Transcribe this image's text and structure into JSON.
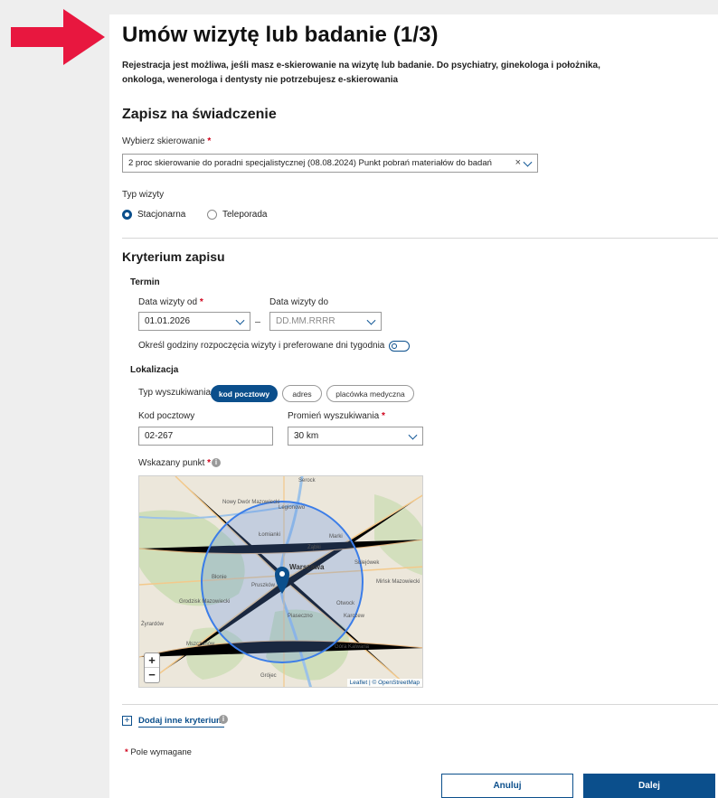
{
  "header": {
    "title": "Umów wizytę lub badanie (1/3)",
    "intro_line1": "Rejestracja jest możliwa, jeśli masz e-skierowanie na wizytę lub badanie. Do psychiatry, ginekologa i położnika,",
    "intro_line2": "onkologa, wenerologa i dentysty nie potrzebujesz e-skierowania"
  },
  "colors": {
    "accent": "#0b4f8c",
    "required": "#d0021b",
    "arrow": "#e8173f",
    "map_circle": "#3b7de8"
  },
  "service": {
    "heading": "Zapisz na świadczenie",
    "referral_label": "Wybierz skierowanie",
    "referral_value": "2 proc skierowanie do poradni specjalistycznej (08.08.2024) Punkt pobrań materiałów do badań",
    "visit_type_label": "Typ wizyty",
    "visit_types": [
      {
        "label": "Stacjonarna",
        "selected": true
      },
      {
        "label": "Teleporada",
        "selected": false
      }
    ]
  },
  "criteria": {
    "heading": "Kryterium zapisu",
    "term_heading": "Termin",
    "date_from_label": "Data wizyty od",
    "date_from_value": "01.01.2026",
    "date_to_label": "Data wizyty do",
    "date_to_placeholder": "DD.MM.RRRR",
    "hours_toggle_label": "Określ godziny rozpoczęcia wizyty i preferowane dni tygodnia",
    "location_heading": "Lokalizacja",
    "search_type_label": "Typ wyszukiwania",
    "search_types": [
      {
        "label": "kod pocztowy",
        "selected": true
      },
      {
        "label": "adres",
        "selected": false
      },
      {
        "label": "placówka medyczna",
        "selected": false
      }
    ],
    "postal_code_label": "Kod pocztowy",
    "postal_code_value": "02-267",
    "radius_label": "Promień wyszukiwania",
    "radius_value": "30 km",
    "point_label": "Wskazany punkt"
  },
  "map": {
    "places": [
      "Serock",
      "Nowy Dwór Mazowiecki",
      "Legionowo",
      "Łomianki",
      "Marki",
      "Ząbki",
      "Sulejówek",
      "Warszawa",
      "Błonie",
      "Pruszków",
      "Grodzisk Mazowiecki",
      "Piaseczno",
      "Otwock",
      "Karczew",
      "Góra Kalwaria",
      "Mińsk Mazowiecki",
      "Grójec",
      "Mszczonów",
      "Żyrardów"
    ],
    "zoom_in": "+",
    "zoom_out": "−",
    "attribution": "Leaflet | © OpenStreetMap"
  },
  "footer": {
    "add_criterion": "Dodaj inne kryterium",
    "required_note": "Pole wymagane",
    "cancel_label": "Anuluj",
    "next_label": "Dalej"
  },
  "marks": {
    "asterisk": "*",
    "info": "i",
    "clear": "×",
    "plus": "+"
  }
}
